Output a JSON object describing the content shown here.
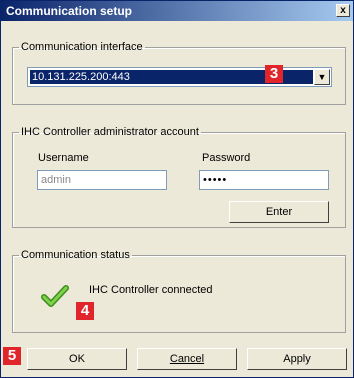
{
  "window": {
    "title": "Communication setup",
    "close_label": "x"
  },
  "interface": {
    "legend": "Communication interface",
    "selected": "10.131.225.200:443",
    "arrow_glyph": "▼"
  },
  "account": {
    "legend": "IHC Controller administrator account",
    "username_label": "Username",
    "username_value": "admin",
    "password_label": "Password",
    "password_value": "•••••",
    "enter_label": "Enter"
  },
  "status": {
    "legend": "Communication status",
    "text": "IHC Controller connected",
    "icon": "check-icon"
  },
  "buttons": {
    "ok": "OK",
    "cancel": "Cancel",
    "apply": "Apply"
  },
  "badges": {
    "b3": "3",
    "b4": "4",
    "b5": "5"
  },
  "colors": {
    "badge": "#e0262b",
    "selection": "#0a246a",
    "check": "#5cb82a"
  }
}
